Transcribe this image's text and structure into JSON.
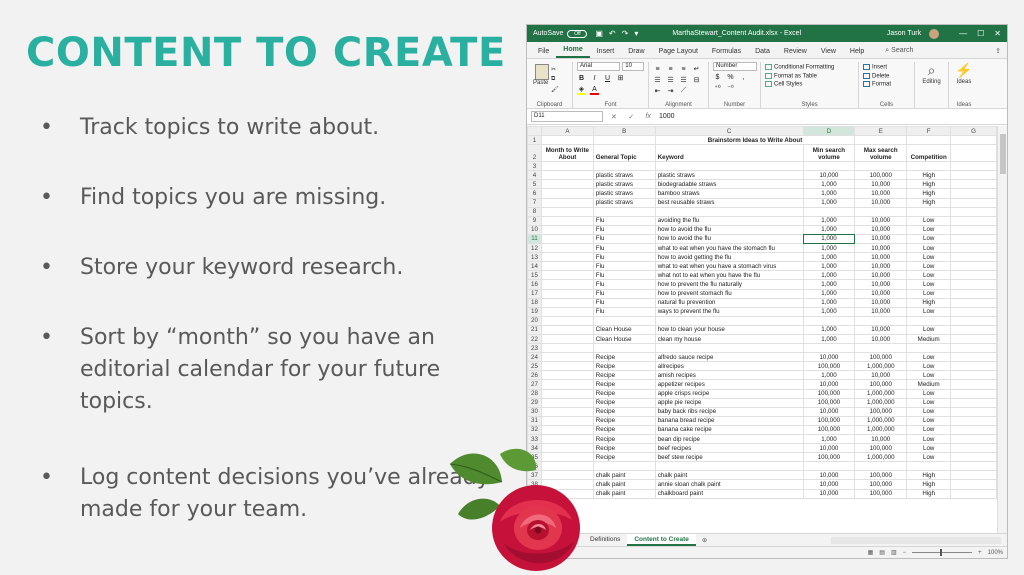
{
  "slide": {
    "title": "CONTENT TO CREATE",
    "bullets": [
      "Track topics to write about.",
      "Find topics you are missing.",
      "Store your keyword research.",
      "Sort by “month” so you have an editorial calendar for your future topics.",
      "Log content decisions you’ve already made for your team."
    ],
    "accent_color": "#2ab0a0"
  },
  "excel": {
    "titlebar": {
      "autosave_label": "AutoSave",
      "autosave_state": "Off",
      "filename": "MarthaStewart_Content Audit.xlsx - Excel",
      "user": "Jason Turk",
      "color": "#217346"
    },
    "tabs": [
      "File",
      "Home",
      "Insert",
      "Draw",
      "Page Layout",
      "Formulas",
      "Data",
      "Review",
      "View",
      "Help"
    ],
    "active_tab": "Home",
    "search_label": "Search",
    "ribbon": {
      "clipboard": {
        "paste": "Paste",
        "label": "Clipboard"
      },
      "font": {
        "name": "Arial",
        "size": "10",
        "label": "Font"
      },
      "alignment": {
        "label": "Alignment"
      },
      "number": {
        "format": "Number",
        "label": "Number"
      },
      "styles": {
        "conditional": "Conditional Formatting",
        "table": "Format as Table",
        "cell": "Cell Styles",
        "label": "Styles"
      },
      "cells": {
        "insert": "Insert",
        "delete": "Delete",
        "format": "Format",
        "label": "Cells"
      },
      "editing": {
        "label": "Editing"
      },
      "ideas": {
        "label": "Ideas",
        "group": "Ideas"
      }
    },
    "formula_bar": {
      "name_box": "D11",
      "fx": "fx",
      "value": "1000"
    },
    "columns": [
      "A",
      "B",
      "C",
      "D",
      "E",
      "F",
      "G"
    ],
    "sheet_title": "Brainstorm Ideas to Write About",
    "headers": {
      "a": "Month to Write About",
      "b": "General Topic",
      "c": "Keyword",
      "d": "Min search volume",
      "e": "Max search volume",
      "f": "Competition"
    },
    "rows": [
      [
        "3",
        "",
        "",
        "",
        "",
        "",
        ""
      ],
      [
        "4",
        "",
        "plastic straws",
        "plastic straws",
        "10,000",
        "100,000",
        "High"
      ],
      [
        "5",
        "",
        "plastic straws",
        "biodegradable straws",
        "1,000",
        "10,000",
        "High"
      ],
      [
        "6",
        "",
        "plastic straws",
        "bamboo straws",
        "1,000",
        "10,000",
        "High"
      ],
      [
        "7",
        "",
        "plastic straws",
        "best reusable straws",
        "1,000",
        "10,000",
        "High"
      ],
      [
        "8",
        "",
        "",
        "",
        "",
        "",
        ""
      ],
      [
        "9",
        "",
        "Flu",
        "avoiding the flu",
        "1,000",
        "10,000",
        "Low"
      ],
      [
        "10",
        "",
        "Flu",
        "how to avoid the flu",
        "1,000",
        "10,000",
        "Low"
      ],
      [
        "11",
        "",
        "Flu",
        "how to avoid the flu",
        "1,000",
        "10,000",
        "Low"
      ],
      [
        "12",
        "",
        "Flu",
        "what to eat when you have the stomach flu",
        "1,000",
        "10,000",
        "Low"
      ],
      [
        "13",
        "",
        "Flu",
        "how to avoid getting the flu",
        "1,000",
        "10,000",
        "Low"
      ],
      [
        "14",
        "",
        "Flu",
        "what to eat when you have a stomach virus",
        "1,000",
        "10,000",
        "Low"
      ],
      [
        "15",
        "",
        "Flu",
        "what not to eat when you have the flu",
        "1,000",
        "10,000",
        "Low"
      ],
      [
        "16",
        "",
        "Flu",
        "how to prevent the flu naturally",
        "1,000",
        "10,000",
        "Low"
      ],
      [
        "17",
        "",
        "Flu",
        "how to prevent stomach flu",
        "1,000",
        "10,000",
        "Low"
      ],
      [
        "18",
        "",
        "Flu",
        "natural flu prevention",
        "1,000",
        "10,000",
        "High"
      ],
      [
        "19",
        "",
        "Flu",
        "ways to prevent the flu",
        "1,000",
        "10,000",
        "Low"
      ],
      [
        "20",
        "",
        "",
        "",
        "",
        "",
        ""
      ],
      [
        "21",
        "",
        "Clean House",
        "how to clean your house",
        "1,000",
        "10,000",
        "Low"
      ],
      [
        "22",
        "",
        "Clean House",
        "clean my house",
        "1,000",
        "10,000",
        "Medium"
      ],
      [
        "23",
        "",
        "",
        "",
        "",
        "",
        ""
      ],
      [
        "24",
        "",
        "Recipe",
        "alfredo sauce recipe",
        "10,000",
        "100,000",
        "Low"
      ],
      [
        "25",
        "",
        "Recipe",
        "allrecipes",
        "100,000",
        "1,000,000",
        "Low"
      ],
      [
        "26",
        "",
        "Recipe",
        "amish recipes",
        "1,000",
        "10,000",
        "Low"
      ],
      [
        "27",
        "",
        "Recipe",
        "appetizer recipes",
        "10,000",
        "100,000",
        "Medium"
      ],
      [
        "28",
        "",
        "Recipe",
        "apple crisps recipe",
        "100,000",
        "1,000,000",
        "Low"
      ],
      [
        "29",
        "",
        "Recipe",
        "apple pie recipe",
        "100,000",
        "1,000,000",
        "Low"
      ],
      [
        "30",
        "",
        "Recipe",
        "baby back ribs recipe",
        "10,000",
        "100,000",
        "Low"
      ],
      [
        "31",
        "",
        "Recipe",
        "banana bread recipe",
        "100,000",
        "1,000,000",
        "Low"
      ],
      [
        "32",
        "",
        "Recipe",
        "banana cake recipe",
        "100,000",
        "1,000,000",
        "Low"
      ],
      [
        "33",
        "",
        "Recipe",
        "bean dip recipe",
        "1,000",
        "10,000",
        "Low"
      ],
      [
        "34",
        "",
        "Recipe",
        "beef recipes",
        "10,000",
        "100,000",
        "Low"
      ],
      [
        "35",
        "",
        "Recipe",
        "beef stew recipe",
        "100,000",
        "1,000,000",
        "Low"
      ],
      [
        "36",
        "",
        "",
        "",
        "",
        "",
        ""
      ],
      [
        "37",
        "",
        "chalk paint",
        "chalk paint",
        "10,000",
        "100,000",
        "High"
      ],
      [
        "38",
        "",
        "chalk paint",
        "annie sloan chalk paint",
        "10,000",
        "100,000",
        "High"
      ],
      [
        "39",
        "",
        "chalk paint",
        "chalkboard paint",
        "10,000",
        "100,000",
        "High"
      ]
    ],
    "selected_row": "11",
    "sheet_tabs": [
      "Definitions",
      "Content to Create"
    ],
    "active_sheet": "Content to Create",
    "zoom": "100%"
  }
}
